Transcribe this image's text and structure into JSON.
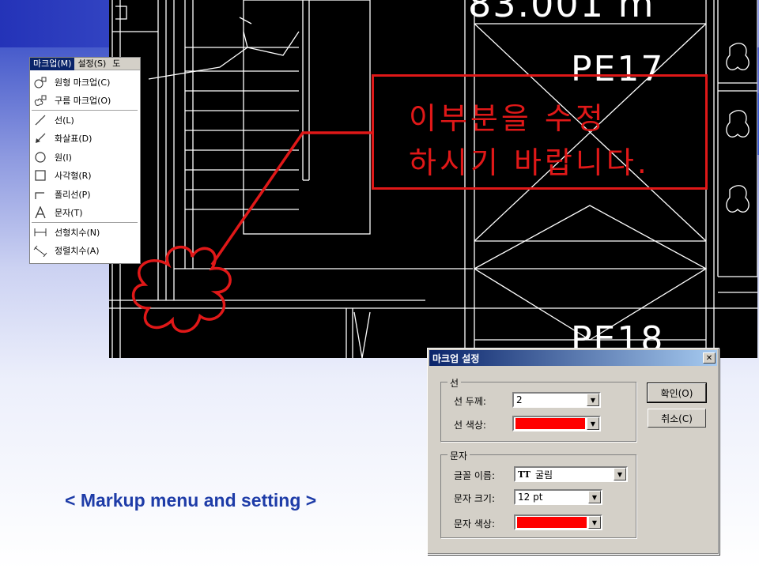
{
  "cad": {
    "label_top": "PE17",
    "label_bottom": "PE18",
    "label_partial": "83.001 m",
    "annotation_line1": "이부분을 수정",
    "annotation_line2": "하시기 바랍니다.",
    "markup_color": "#e01818"
  },
  "menu": {
    "bar": [
      {
        "label": "마크업(M)",
        "active": true
      },
      {
        "label": "설정(S)",
        "active": false
      },
      {
        "label": "도",
        "active": false
      }
    ],
    "items": [
      {
        "icon": "circle-markup-icon",
        "label": "원형 마크업(C)"
      },
      {
        "icon": "cloud-markup-icon",
        "label": "구름 마크업(O)"
      },
      {
        "sep": true
      },
      {
        "icon": "line-icon",
        "label": "선(L)"
      },
      {
        "icon": "arrow-icon",
        "label": "화살표(D)"
      },
      {
        "icon": "circle-icon",
        "label": "원(I)"
      },
      {
        "icon": "rectangle-icon",
        "label": "사각형(R)"
      },
      {
        "icon": "polyline-icon",
        "label": "폴리선(P)"
      },
      {
        "icon": "text-icon",
        "label": "문자(T)"
      },
      {
        "sep": true
      },
      {
        "icon": "linear-dimension-icon",
        "label": "선형치수(N)"
      },
      {
        "icon": "aligned-dimension-icon",
        "label": "정렬치수(A)"
      }
    ]
  },
  "caption": "< Markup menu and setting >",
  "dialog": {
    "title": "마크업 설정",
    "line_group": "선",
    "line_width_label": "선 두께:",
    "line_width_value": "2",
    "line_color_label": "선 색상:",
    "line_color": "#ff0000",
    "text_group": "문자",
    "font_label": "글꼴 이름:",
    "font_value": "굴림",
    "font_size_label": "문자 크기:",
    "font_size_value": "12 pt",
    "text_color_label": "문자 색상:",
    "text_color": "#ff0000",
    "ok_label": "확인(O)",
    "cancel_label": "취소(C)"
  }
}
